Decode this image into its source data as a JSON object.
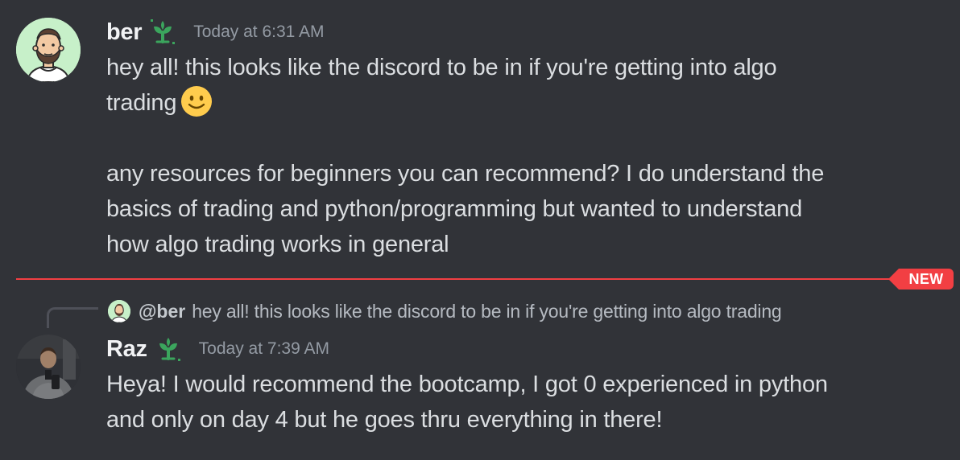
{
  "messages": [
    {
      "username": "ber",
      "timestamp": "Today at 6:31 AM",
      "badge_icon": "sprout-icon",
      "lines": {
        "l1": "hey all! this looks like the discord to be in if you're getting into algo",
        "l2": "trading",
        "l3": "any resources for beginners you can recommend? I do understand the",
        "l4": "basics of trading and python/programming but wanted to understand",
        "l5": "how algo trading works in general"
      },
      "emoji": "slightly-smiling-face-icon"
    },
    {
      "username": "Raz",
      "timestamp": "Today at 7:39 AM",
      "badge_icon": "sprout-icon",
      "reply": {
        "mention": "@ber",
        "text": "hey all! this looks like the discord to be in if you're getting into algo trading"
      },
      "lines": {
        "l1": "Heya! I would recommend the bootcamp, I got 0 experienced in python",
        "l2": "and only on day 4 but he goes thru everything in there!"
      }
    }
  ],
  "divider": {
    "label": "NEW",
    "color": "#f23f43"
  },
  "colors": {
    "background": "#313338",
    "username": "#f2f3f5",
    "text": "#dbdee1",
    "muted": "#949ba4",
    "sprout": "#3ba55d"
  }
}
